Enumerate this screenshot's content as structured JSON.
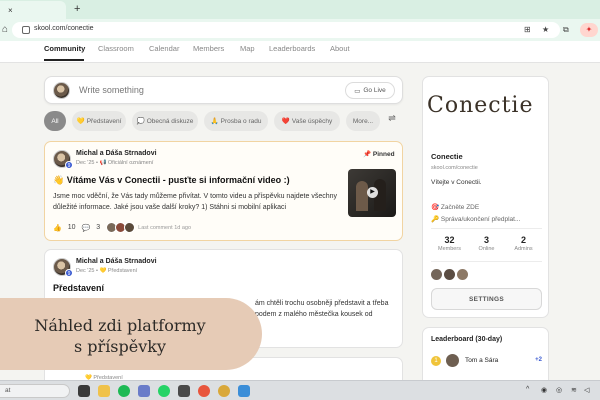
{
  "browser": {
    "url": "skool.com/conectie",
    "tab_close": "×",
    "new_tab": "+"
  },
  "nav": {
    "items": [
      {
        "label": "Community",
        "active": true
      },
      {
        "label": "Classroom"
      },
      {
        "label": "Calendar"
      },
      {
        "label": "Members"
      },
      {
        "label": "Map"
      },
      {
        "label": "Leaderboards"
      },
      {
        "label": "About"
      }
    ]
  },
  "composer": {
    "placeholder": "Write something",
    "go_live": "Go Live"
  },
  "filters": [
    {
      "label": "All",
      "active": true
    },
    {
      "label": "Představení",
      "emoji": "💛"
    },
    {
      "label": "Obecná diskuze",
      "emoji": "💭"
    },
    {
      "label": "Prosba o radu",
      "emoji": "🙏"
    },
    {
      "label": "Vaše úspěchy",
      "emoji": "❤️"
    },
    {
      "label": "More..."
    }
  ],
  "posts": [
    {
      "author": "Michal a Dáša Strnadovi",
      "meta": "Dec '25 • 📢 Oficiální oznámení",
      "level": "9",
      "pinned": "Pinned",
      "title": "👋 Vítáme Vás v Conectii - pusťte si informační video :)",
      "body": "Jsme moc vděční, že Vás tady můžeme přivítat. V tomto videu a příspěvku najdete všechny důležité informace. Jaké jsou vaše další kroky? 1) Stáhni si mobilní aplikaci",
      "likes": "10",
      "comments": "3",
      "last_comment": "Last comment 1d ago"
    },
    {
      "author": "Michal a Dáša Strnadovi",
      "meta": "Dec '25 • 💛 Představení",
      "level": "9",
      "title": "Představení",
      "excerpt": "ám chtěli trochu osobněji představit a třeba podem z malého městečka kousek od"
    },
    {
      "meta": "💛 Představení"
    }
  ],
  "sidebar": {
    "logo": "Conectie",
    "name": "Conectie",
    "url": "skool.com/conectie",
    "description": "Vítejte v Conectii.",
    "links": [
      {
        "label": "🎯 Začněte ZDE"
      },
      {
        "label": "🔑 Správa/ukončení předplat..."
      }
    ],
    "stats": [
      {
        "value": "32",
        "label": "Members"
      },
      {
        "value": "3",
        "label": "Online"
      },
      {
        "value": "2",
        "label": "Admins"
      }
    ],
    "settings": "SETTINGS"
  },
  "leaderboard": {
    "title": "Leaderboard (30-day)",
    "rows": [
      {
        "rank": "1",
        "name": "Tom a Sára",
        "points": "+2"
      }
    ]
  },
  "overlay": {
    "line1": "Náhled zdi platformy",
    "line2": "s příspěvky"
  },
  "taskbar": {
    "search_text": "at"
  }
}
